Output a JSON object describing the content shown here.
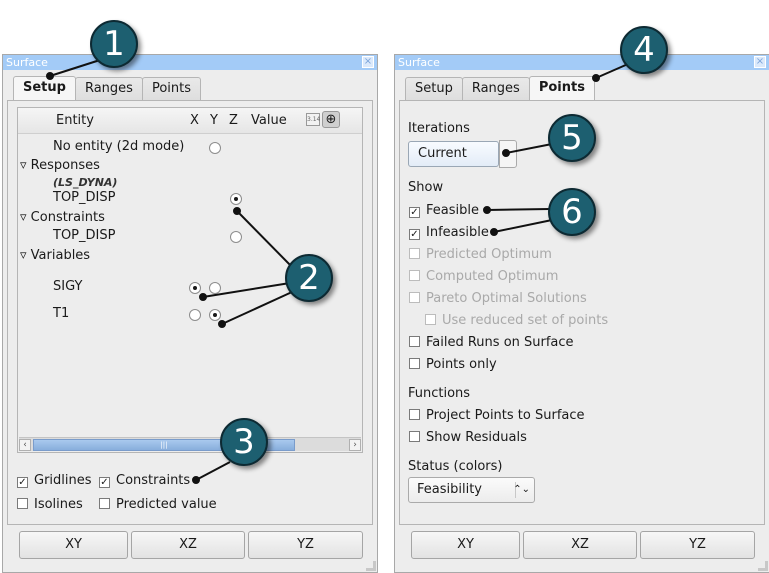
{
  "left_panel": {
    "title": "Surface",
    "tabs": [
      {
        "label": "Setup",
        "active": true
      },
      {
        "label": "Ranges",
        "active": false
      },
      {
        "label": "Points",
        "active": false
      }
    ],
    "tree": {
      "headers": {
        "entity": "Entity",
        "x": "X",
        "y": "Y",
        "z": "Z",
        "value": "Value"
      },
      "header_icons": [
        "number-format-icon",
        "pin-icon"
      ],
      "no_entity": "No entity (2d mode)",
      "groups": {
        "responses": "Responses",
        "responses_source": "(LS_DYNA)",
        "responses_item": "TOP_DISP",
        "constraints": "Constraints",
        "constraints_item": "TOP_DISP",
        "variables": "Variables",
        "var1": "SIGY",
        "var2": "T1"
      },
      "selection": {
        "x": "SIGY",
        "y": "T1",
        "z": "TOP_DISP (Responses)"
      }
    },
    "options": [
      {
        "label": "Gridlines",
        "checked": true
      },
      {
        "label": "Constraints",
        "checked": true
      },
      {
        "label": "Isolines",
        "checked": false
      },
      {
        "label": "Predicted value",
        "checked": false
      }
    ],
    "buttons": [
      "XY",
      "XZ",
      "YZ"
    ]
  },
  "right_panel": {
    "title": "Surface",
    "tabs": [
      {
        "label": "Setup",
        "active": false
      },
      {
        "label": "Ranges",
        "active": false
      },
      {
        "label": "Points",
        "active": true
      }
    ],
    "iterations_label": "Iterations",
    "iterations_value": "Current",
    "show_label": "Show",
    "show_options": [
      {
        "label": "Feasible",
        "checked": true,
        "enabled": true
      },
      {
        "label": "Infeasible",
        "checked": true,
        "enabled": true
      },
      {
        "label": "Predicted Optimum",
        "checked": false,
        "enabled": false
      },
      {
        "label": "Computed Optimum",
        "checked": false,
        "enabled": false
      },
      {
        "label": "Pareto Optimal Solutions",
        "checked": false,
        "enabled": false
      },
      {
        "label": "Use reduced set of points",
        "checked": false,
        "enabled": false
      },
      {
        "label": "Failed Runs on Surface",
        "checked": false,
        "enabled": true
      },
      {
        "label": "Points only",
        "checked": false,
        "enabled": true
      }
    ],
    "functions_label": "Functions",
    "function_options": [
      {
        "label": "Project Points to Surface",
        "checked": false
      },
      {
        "label": "Show Residuals",
        "checked": false
      }
    ],
    "status_label": "Status (colors)",
    "status_value": "Feasibility",
    "buttons": [
      "XY",
      "XZ",
      "YZ"
    ]
  },
  "callouts": [
    "1",
    "2",
    "3",
    "4",
    "5",
    "6"
  ],
  "colors": {
    "callout_fill": "#1d5f70",
    "titlebar": "#a3cbf7",
    "panel_bg": "#ededed"
  }
}
